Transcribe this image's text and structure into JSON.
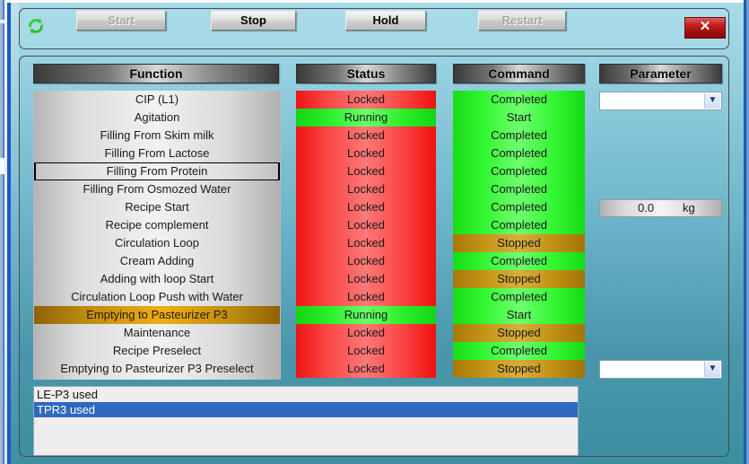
{
  "toolbar": {
    "refresh_icon": "refresh-icon",
    "buttons": [
      {
        "label": "Start",
        "enabled": false
      },
      {
        "label": "Stop",
        "enabled": true
      },
      {
        "label": "Hold",
        "enabled": true
      },
      {
        "label": "Restart",
        "enabled": false
      }
    ],
    "close_label": "✕"
  },
  "columns": {
    "function": "Function",
    "status": "Status",
    "command": "Command",
    "parameter": "Parameter"
  },
  "rows": [
    {
      "function": "CIP (L1)",
      "status": "Locked",
      "command": "Completed",
      "selection": "none"
    },
    {
      "function": "Agitation",
      "status": "Running",
      "command": "Start",
      "selection": "none"
    },
    {
      "function": "Filling From Skim milk",
      "status": "Locked",
      "command": "Completed",
      "selection": "none"
    },
    {
      "function": "Filling From Lactose",
      "status": "Locked",
      "command": "Completed",
      "selection": "none"
    },
    {
      "function": "Filling From Protein",
      "status": "Locked",
      "command": "Completed",
      "selection": "focus"
    },
    {
      "function": "Filling From Osmozed Water",
      "status": "Locked",
      "command": "Completed",
      "selection": "none"
    },
    {
      "function": "Recipe Start",
      "status": "Locked",
      "command": "Completed",
      "selection": "none"
    },
    {
      "function": "Recipe complement",
      "status": "Locked",
      "command": "Completed",
      "selection": "none"
    },
    {
      "function": "Circulation Loop",
      "status": "Locked",
      "command": "Stopped",
      "selection": "none"
    },
    {
      "function": "Cream Adding",
      "status": "Locked",
      "command": "Completed",
      "selection": "none"
    },
    {
      "function": "Adding with loop Start",
      "status": "Locked",
      "command": "Stopped",
      "selection": "none"
    },
    {
      "function": "Circulation Loop Push with Water",
      "status": "Locked",
      "command": "Completed",
      "selection": "none"
    },
    {
      "function": "Emptying to Pasteurizer P3",
      "status": "Running",
      "command": "Start",
      "selection": "orange"
    },
    {
      "function": "Maintenance",
      "status": "Locked",
      "command": "Stopped",
      "selection": "none"
    },
    {
      "function": "Recipe Preselect",
      "status": "Locked",
      "command": "Completed",
      "selection": "none"
    },
    {
      "function": "Emptying to Pasteurizer P3 Preselect",
      "status": "Locked",
      "command": "Stopped",
      "selection": "none"
    }
  ],
  "parameter": {
    "combo_top_value": "",
    "combo_bottom_value": "",
    "readout_value": "0.0",
    "readout_unit": "kg",
    "arrow_glyph": "▼"
  },
  "messages": [
    {
      "text": "LE-P3 used",
      "selected": false
    },
    {
      "text": "TPR3 used",
      "selected": true
    }
  ],
  "colors": {
    "locked": "#ff4040",
    "running": "#2cf02c",
    "completed": "#2ff52f",
    "stopped": "#c39313",
    "selection_orange": "#f0ad14",
    "selection_blue": "#2f68bf",
    "close_red": "#c42020",
    "background_teal": "#6fb6ca"
  }
}
